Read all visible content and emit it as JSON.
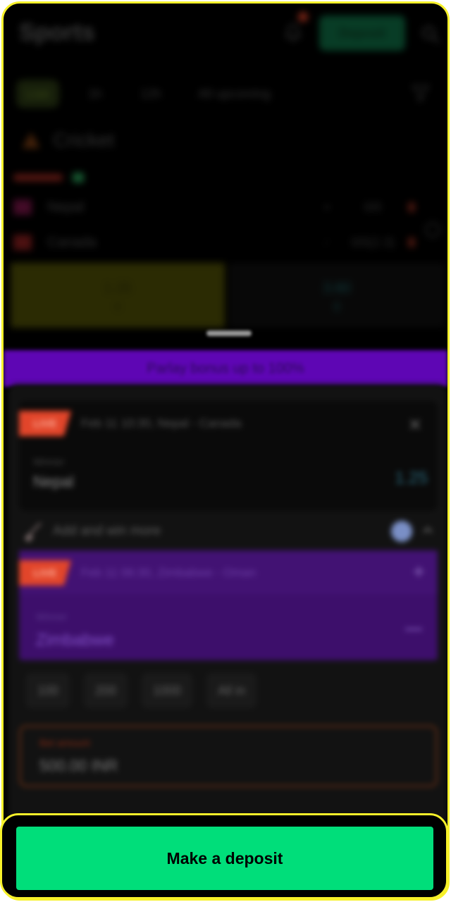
{
  "header": {
    "title": "Sports",
    "deposit_label": "Deposit",
    "notification_icon": "bell-icon",
    "search_icon": "search-icon"
  },
  "filters": {
    "items": [
      "Live",
      "1h",
      "12h",
      "All upcoming"
    ],
    "active": "Live",
    "filter_icon": "filter-icon"
  },
  "sport": {
    "name": "Cricket",
    "icon": "cricket-icon"
  },
  "match": {
    "teams": [
      {
        "name": "Nepal",
        "flag_color": "#c2184b",
        "score": "0/0"
      },
      {
        "name": "Canada",
        "flag_color": "#d32f2f",
        "score": "0/0(2.3)"
      }
    ],
    "odds": [
      "1.25",
      "3.60"
    ],
    "odd1_color": "#4f4f07"
  },
  "promo": {
    "text": "Parlay bonus up to 100%"
  },
  "bet_slip": {
    "coupon": {
      "badge": "LIVE",
      "title": "Feb 11 10:30, Nepal - Canada",
      "market": "Winner",
      "outcome": "Nepal",
      "odd": "1.25"
    },
    "add_and_win": {
      "label": "Add and win more"
    },
    "suggestion": {
      "badge": "LIVE",
      "title": "Feb 11 06:30, Zimbabwe - Oman",
      "market": "Winner",
      "outcome": "Zimbabwe"
    },
    "stakes": [
      "100",
      "200",
      "1000",
      "All in"
    ],
    "bet_amount": {
      "label": "Bet amount",
      "value": "500.00 INR"
    }
  },
  "cta": {
    "label": "Make a deposit",
    "color": "#00de7a"
  }
}
